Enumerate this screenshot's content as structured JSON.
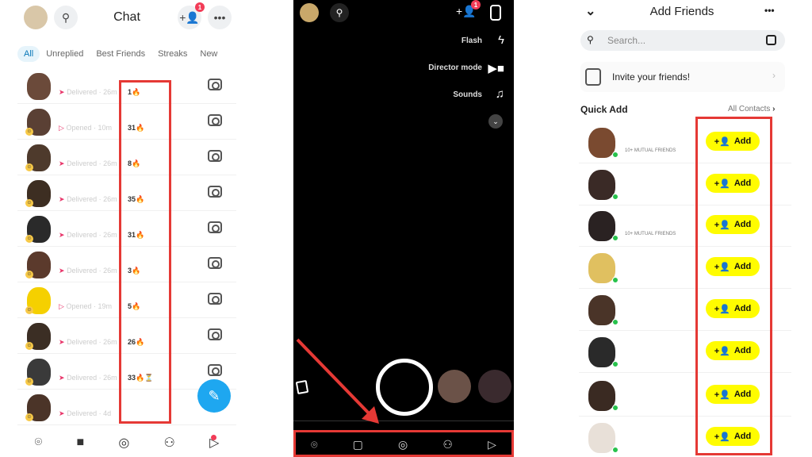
{
  "chat": {
    "title": "Chat",
    "add_friend_badge": "1",
    "tabs": [
      "All",
      "Unreplied",
      "Best Friends",
      "Streaks",
      "New"
    ],
    "rows": [
      {
        "status": "Delivered",
        "time": "26m",
        "streak": "1🔥",
        "opened": false
      },
      {
        "status": "Opened",
        "time": "10m",
        "streak": "31🔥",
        "opened": true
      },
      {
        "status": "Delivered",
        "time": "26m",
        "streak": "8🔥",
        "opened": false
      },
      {
        "status": "Delivered",
        "time": "26m",
        "streak": "35🔥",
        "opened": false
      },
      {
        "status": "Delivered",
        "time": "26m",
        "streak": "31🔥",
        "opened": false
      },
      {
        "status": "Delivered",
        "time": "26m",
        "streak": "3🔥",
        "opened": false
      },
      {
        "status": "Opened",
        "time": "19m",
        "streak": "5🔥",
        "opened": true
      },
      {
        "status": "Delivered",
        "time": "26m",
        "streak": "26🔥",
        "opened": false
      },
      {
        "status": "Delivered",
        "time": "26m",
        "streak": "33🔥⏳",
        "opened": false
      },
      {
        "status": "Delivered",
        "time": "4d",
        "streak": "",
        "opened": false
      }
    ],
    "nav": [
      "map-pin-icon",
      "chat-icon",
      "camera-icon",
      "friends-icon",
      "stories-play-icon"
    ]
  },
  "camera": {
    "add_friend_badge": "1",
    "flash": "Flash",
    "director_mode": "Director mode",
    "sounds": "Sounds"
  },
  "add_friends": {
    "title": "Add Friends",
    "search_placeholder": "Search...",
    "invite": "Invite your friends!",
    "quick_add": "Quick Add",
    "all_contacts": "All Contacts",
    "add_label": "Add",
    "mutual_label": "10+ MUTUAL FRIENDS",
    "rows": 8
  },
  "colors": {
    "accent_yellow": "#fffc00",
    "highlight_red": "#e53935",
    "chat_blue": "#1ea7f0",
    "delivered_red": "#e8356a"
  }
}
